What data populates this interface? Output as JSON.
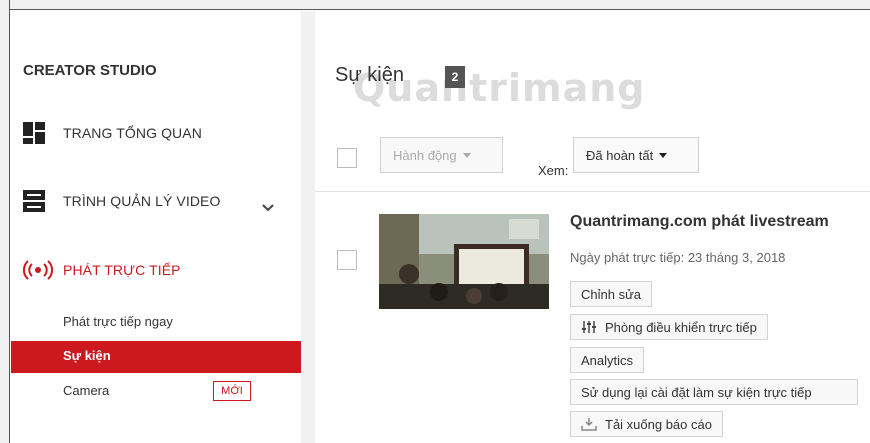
{
  "sidebar": {
    "title": "CREATOR STUDIO",
    "items": [
      {
        "label": "TRANG TỔNG QUAN",
        "icon": "dashboard-icon"
      },
      {
        "label": "TRÌNH QUẢN LÝ VIDEO",
        "icon": "video-manager-icon"
      },
      {
        "label": "PHÁT TRỰC TIẾP",
        "icon": "live-broadcast-icon",
        "color": "#cc181e"
      }
    ],
    "sub_items": [
      {
        "label": "Phát trực tiếp ngay"
      },
      {
        "label": "Sự kiện",
        "active": true
      },
      {
        "label": "Camera",
        "badge": "MỚI"
      }
    ]
  },
  "main": {
    "title": "Sự kiện",
    "count": "2",
    "watermark": "Quantrimang",
    "toolbar": {
      "actions_label": "Hành động",
      "view_label": "Xem:",
      "view_value": "Đã hoàn tất"
    },
    "video": {
      "title": "Quantrimang.com phát livestream",
      "date": "Ngày phát trực tiếp: 23 tháng 3, 2018",
      "actions": [
        {
          "label": "Chỉnh sửa"
        },
        {
          "label": "Phòng điều khiển trực tiếp",
          "icon": "control-room-icon"
        },
        {
          "label": "Analytics"
        },
        {
          "label": "Sử dụng lại cài đặt làm sự kiện trực tiếp"
        },
        {
          "label": "Tải xuống báo cáo",
          "icon": "download-icon"
        }
      ]
    }
  },
  "colors": {
    "accent": "#cc181e",
    "badge": "#555555"
  }
}
